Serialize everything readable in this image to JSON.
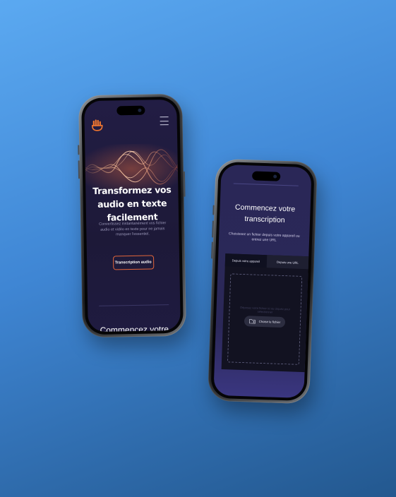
{
  "colors": {
    "background_top": "#5ba9f1",
    "background_bottom": "#23588f",
    "screen_dark": "#1d1938",
    "screen_purple": "#2b2858",
    "accent_orange": "#e2663a",
    "upload_card": "#121221"
  },
  "phone1": {
    "header": {
      "logo_icon": "hand-logo-icon",
      "menu_icon": "hamburger-menu-icon"
    },
    "hero": {
      "title": "Transformez vos audio en texte facilement",
      "subtitle": "Convertissez instantanément vos fichier audio et vidéo en texte pour ne jamais manquer l'essentiel.",
      "cta_label": "Transcription audio"
    },
    "next_section_peek": "Commencez votre"
  },
  "phone2": {
    "section": {
      "title": "Commencez votre transcription",
      "subtitle": "Choisissez un fichier depuis votre appareil ou entrez une URL"
    },
    "tabs": [
      {
        "label": "Depuis votre appareil",
        "active": true
      },
      {
        "label": "Depuis une URL",
        "active": false
      }
    ],
    "dropzone": {
      "hint": "Déposez votre fichier ici ou cliquez pour sélectionner",
      "button_label": "Choisir le fichier",
      "button_icon": "file-folder-icon"
    }
  }
}
